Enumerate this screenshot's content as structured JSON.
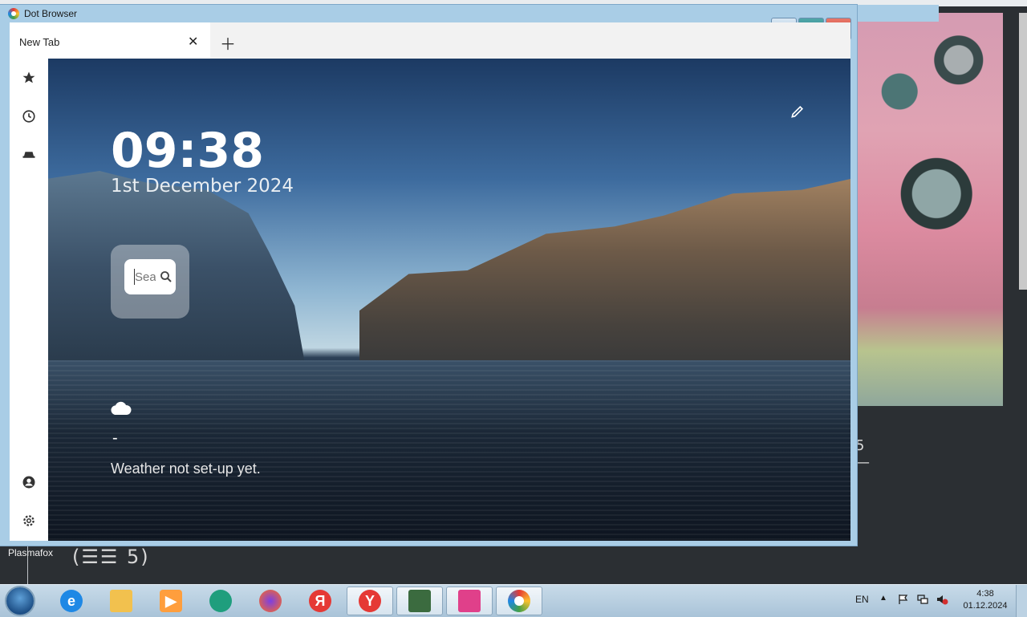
{
  "window": {
    "title": "Dot Browser"
  },
  "tabs": [
    {
      "label": "New Tab"
    }
  ],
  "newtab": {
    "time": "09:38",
    "date": "1st December 2024",
    "search_placeholder": "Search",
    "weather_value": "-",
    "weather_text": "Weather not set-up yet."
  },
  "sidebar": {
    "items": [
      {
        "icon": "star-icon"
      },
      {
        "icon": "history-icon"
      },
      {
        "icon": "incognito-icon"
      },
      {
        "icon": "account-icon"
      },
      {
        "icon": "settings-icon"
      }
    ]
  },
  "desktop": {
    "label": "Plasmafox",
    "icon_text": "(☰☰ 5)",
    "bg_dash": "5 —"
  },
  "taskbar": {
    "apps": [
      "ie-icon",
      "explorer-icon",
      "media-player-icon",
      "globe-app-icon",
      "firefox-icon",
      "yandex-icon",
      "yandex-browser-icon",
      "terminal-icon",
      "pink-app-icon",
      "dot-browser-icon"
    ],
    "yandex_letter": "Я",
    "yandex_browser_letter": "Y",
    "language": "EN",
    "tray_arrow": "▲",
    "time": "4:38",
    "date": "01.12.2024"
  },
  "colors": {
    "titlebar": "#a9cde6",
    "close": "#c8392b",
    "maximize": "#2b7c8a"
  }
}
